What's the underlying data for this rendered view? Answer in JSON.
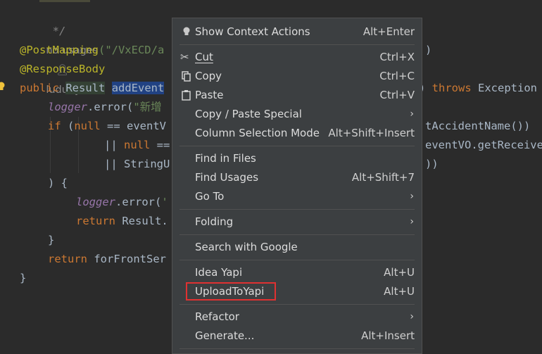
{
  "editor": {
    "code": {
      "comment_end": " */",
      "usages_hint": "no usages",
      "author_hint": "ludunyue",
      "post_mapping": "@PostMapping",
      "post_mapping_args": "(\"/VxECD/a",
      "post_mapping_tail": ")",
      "response_body": "@ResponseBody",
      "kw_public": "public",
      "type_result": "Result",
      "method_partial": "addEvent",
      "throws_prefix": ") ",
      "kw_throws": "throws",
      "exception_partial": " Exception",
      "logger": "logger",
      "error_call": ".error(",
      "cn_string": "\"新增",
      "kw_if": "if",
      "if_open": " (",
      "kw_null": "null",
      "if_rest": " == eventV",
      "accident_tail": "tAccidentName())",
      "pipes": "|| ",
      "null_eq_rest": " ==",
      "receive_tail": "eventVO.getReceive",
      "string_partial": "StringU",
      "close_tail": "))",
      "close_paren_brace": ") {",
      "error_call2": ".error(",
      "quote_start": "'",
      "kw_return": "return",
      "result_partial": " Result.",
      "brace_close": "}",
      "fn_front": "forFrontSer"
    }
  },
  "context_menu": {
    "items": [
      {
        "label": "Show Context Actions",
        "shortcut": "Alt+Enter",
        "icon": "lightbulb-icon"
      },
      {
        "label": "Cut",
        "shortcut": "Ctrl+X",
        "icon": "scissors-icon"
      },
      {
        "label": "Copy",
        "shortcut": "Ctrl+C",
        "icon": "copy-icon"
      },
      {
        "label": "Paste",
        "shortcut": "Ctrl+V",
        "icon": "paste-icon"
      },
      {
        "label": "Copy / Paste Special",
        "submenu_arrow": "›"
      },
      {
        "label": "Column Selection Mode",
        "shortcut": "Alt+Shift+Insert"
      },
      {
        "label": "Find in Files"
      },
      {
        "label": "Find Usages",
        "shortcut": "Alt+Shift+7"
      },
      {
        "label": "Go To",
        "submenu_arrow": "›"
      },
      {
        "label": "Folding",
        "submenu_arrow": "›"
      },
      {
        "label": "Search with Google"
      },
      {
        "label": "Idea Yapi",
        "shortcut": "Alt+U"
      },
      {
        "label": "UploadToYapi",
        "shortcut": "Alt+U"
      },
      {
        "label": "Refactor",
        "submenu_arrow": "›"
      },
      {
        "label": "Generate...",
        "shortcut": "Alt+Insert"
      }
    ]
  },
  "colors": {
    "editor_bg": "#2b2b2b",
    "menu_bg": "#3c3f41",
    "highlight_box": "#e03131",
    "keyword": "#cc7832",
    "annotation": "#bbb529",
    "string": "#6a8759",
    "field": "#9876aa"
  }
}
